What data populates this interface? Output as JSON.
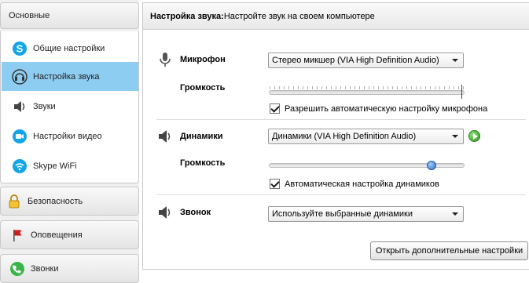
{
  "sidebar": {
    "main_group": "Основные",
    "items": [
      {
        "label": "Общие настройки",
        "icon": "skype-icon"
      },
      {
        "label": "Настройка звука",
        "icon": "headset-icon"
      },
      {
        "label": "Звуки",
        "icon": "speaker-icon"
      },
      {
        "label": "Настройки видео",
        "icon": "video-camera-icon"
      },
      {
        "label": "Skype WiFi",
        "icon": "wifi-icon"
      }
    ],
    "security": "Безопасность",
    "notifications": "Оповещения",
    "calls": "Звонки"
  },
  "header": {
    "title": "Настройка звука:",
    "subtitle": "Настройте звук на своем компьютере"
  },
  "microphone": {
    "label": "Микрофон",
    "device": "Стерео микшер (VIA High Definition Audio)",
    "volume_label": "Громкость",
    "auto_label": "Разрешить автоматическую настройку микрофона",
    "auto_checked": true
  },
  "speakers": {
    "label": "Динамики",
    "device": "Динамики (VIA High Definition Audio)",
    "volume_label": "Громкость",
    "volume_fraction": 0.83,
    "auto_label": "Автоматическая настройка динамиков",
    "auto_checked": true
  },
  "ringer": {
    "label": "Звонок",
    "device": "Используйте выбранные динамики"
  },
  "more_button": "Открыть дополнительные настройки",
  "colors": {
    "active_item": "#8ecdf2",
    "play_green": "#2f9a1f",
    "slider_thumb": "#2f6fc8"
  }
}
